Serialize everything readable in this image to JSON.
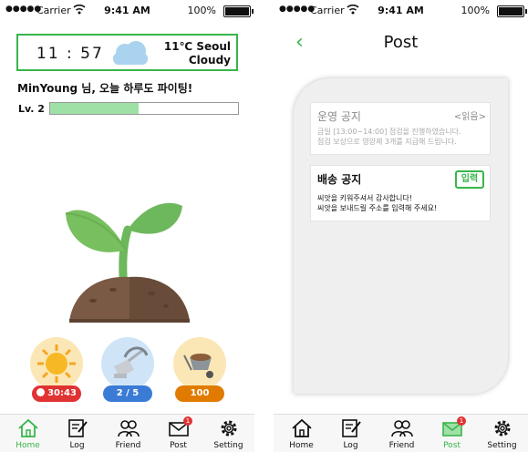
{
  "status_left": {
    "dots": "●●●●●",
    "carrier": "Carrier",
    "time": "9:41 AM",
    "battery": "100%"
  },
  "status_right": {
    "dots": "●●●●●",
    "carrier": "Carrier",
    "time": "9:41 AM",
    "battery": "100%"
  },
  "home": {
    "clock": "11 : 57",
    "temperature": "11℃ Seoul",
    "weather": "Cloudy",
    "greeting": "MinYoung 님, 오늘 하루도 파이팅!",
    "level_label": "Lv. 2",
    "level_progress": 0.47,
    "actions": [
      {
        "name": "sun",
        "value": "30:43",
        "color": "#e03333"
      },
      {
        "name": "water",
        "value": "2 / 5",
        "color": "#3a7bd5"
      },
      {
        "name": "fertilizer",
        "value": "100",
        "color": "#e07b00"
      }
    ]
  },
  "tabs_left": [
    {
      "label": "Home",
      "icon": "home-icon",
      "active": true
    },
    {
      "label": "Log",
      "icon": "log-icon"
    },
    {
      "label": "Friend",
      "icon": "friend-icon"
    },
    {
      "label": "Post",
      "icon": "mail-icon",
      "badge": "1"
    },
    {
      "label": "Setting",
      "icon": "gear-icon"
    }
  ],
  "post": {
    "back": "‹",
    "title": "Post",
    "notices": [
      {
        "title": "운영 공지",
        "tag": "<읽음>",
        "body": [
          "금일 [13:00~14:00] 점검을 진행하였습니다.",
          "점검 보상으로 영양제 3개를 지급해 드립니다."
        ]
      },
      {
        "title": "배송 공지",
        "button": "입력",
        "body": [
          "씨앗을 키워주셔서 감사합니다!",
          "씨앗을 보내드릴 주소를 입력해 주세요!"
        ]
      }
    ]
  },
  "tabs_right": [
    {
      "label": "Home",
      "icon": "home-icon"
    },
    {
      "label": "Log",
      "icon": "log-icon"
    },
    {
      "label": "Friend",
      "icon": "friend-icon"
    },
    {
      "label": "Post",
      "icon": "mail-icon",
      "badge": "1",
      "active": true
    },
    {
      "label": "Setting",
      "icon": "gear-icon"
    }
  ]
}
